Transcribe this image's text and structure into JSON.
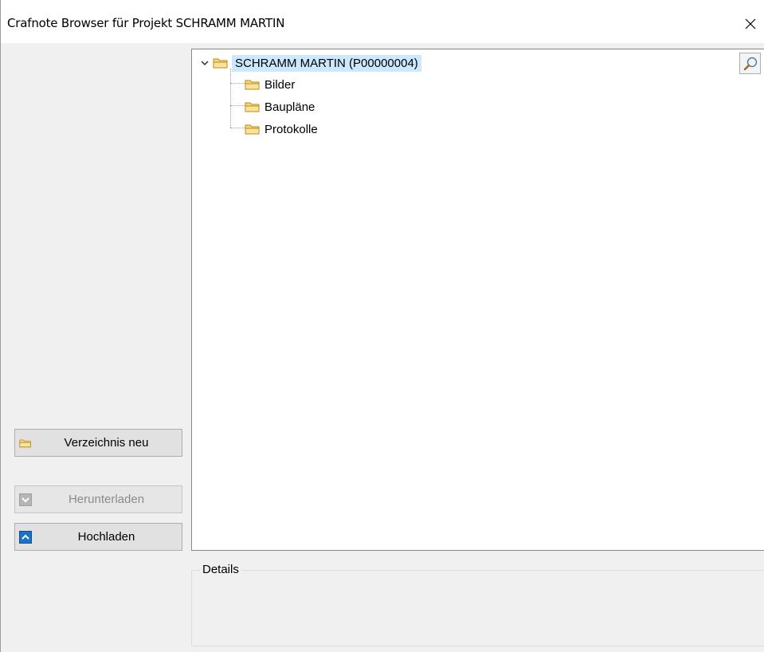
{
  "window": {
    "title": "Crafnote Browser für Projekt SCHRAMM MARTIN"
  },
  "left_panel": {
    "new_folder_label": "Verzeichnis neu",
    "download_label": "Herunterladen",
    "upload_label": "Hochladen"
  },
  "tree": {
    "root": {
      "label": "SCHRAMM MARTIN (P00000004)",
      "expanded": true,
      "selected": true
    },
    "children": [
      {
        "label": "Bilder"
      },
      {
        "label": "Baupläne"
      },
      {
        "label": "Protokolle"
      }
    ]
  },
  "details": {
    "title": "Details"
  },
  "icons": {
    "folder": "folder-icon",
    "search": "magnifier-icon",
    "close": "close-icon"
  },
  "colors": {
    "selection": "#cce8ff",
    "folder_fill": "#f8d775",
    "upload_icon": "#1a72c9"
  }
}
